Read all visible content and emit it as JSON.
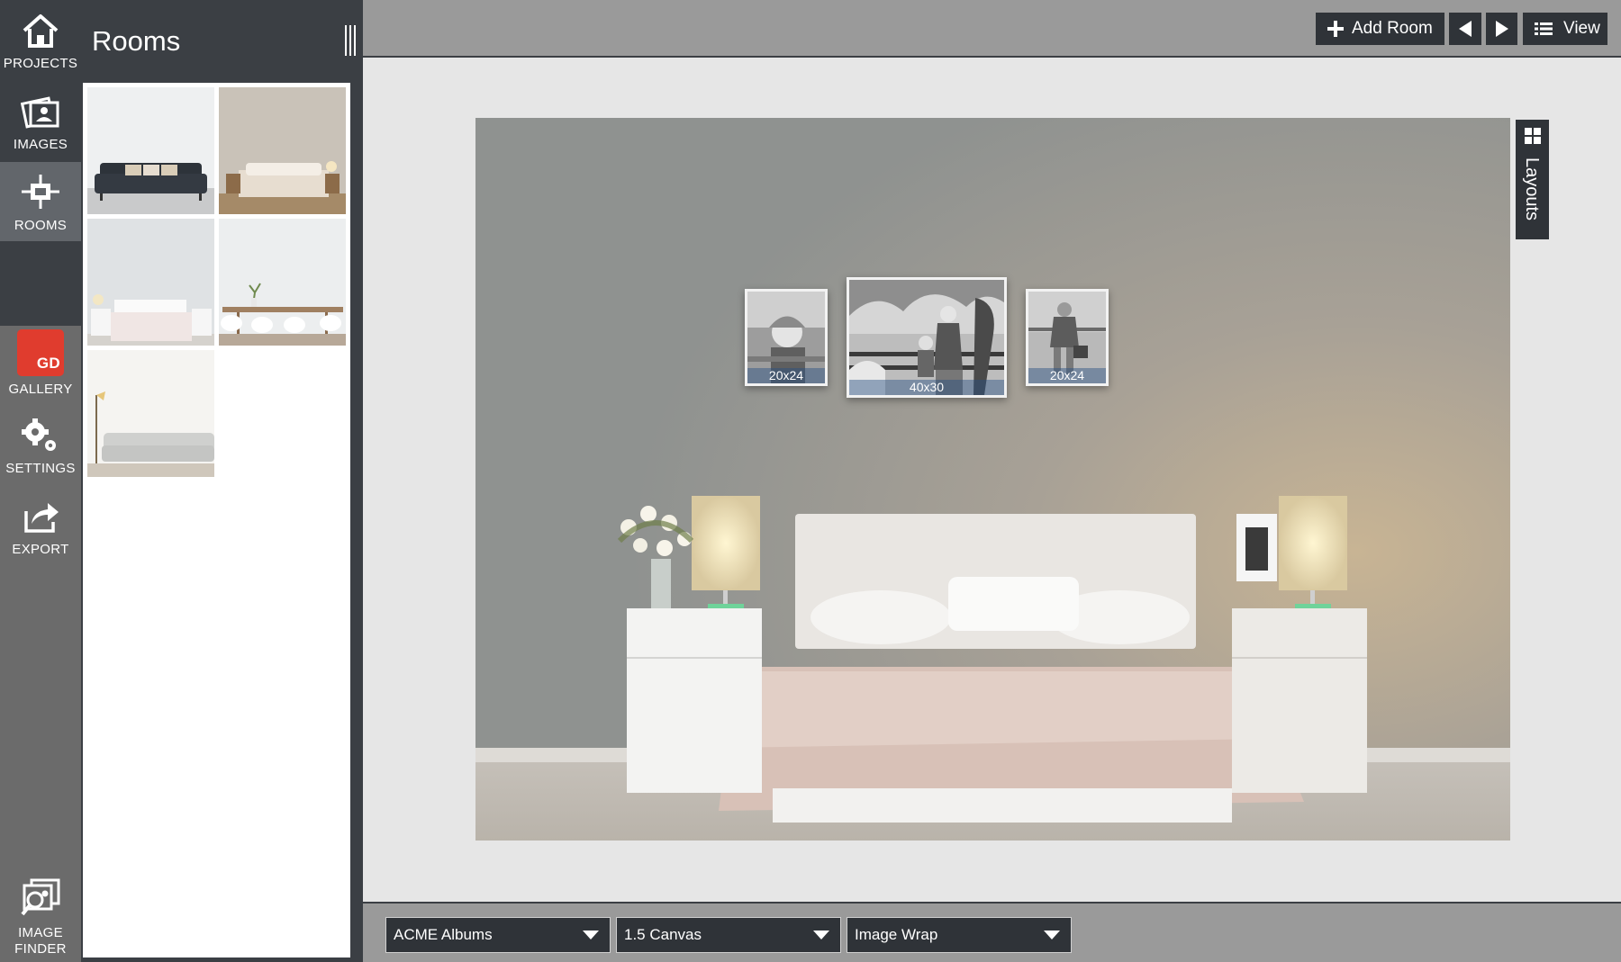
{
  "nav": {
    "projects": "PROJECTS",
    "images": "IMAGES",
    "rooms": "ROOMS",
    "gallery": "GALLERY",
    "gallery_badge": "GD",
    "settings": "SETTINGS",
    "export": "EXPORT",
    "image_finder_1": "IMAGE",
    "image_finder_2": "FINDER"
  },
  "panel": {
    "title": "Rooms"
  },
  "toolbar": {
    "add_room": "Add Room",
    "view": "View"
  },
  "layouts": {
    "label": "Layouts"
  },
  "artworks": [
    {
      "size": "20x24"
    },
    {
      "size": "40x30"
    },
    {
      "size": "20x24"
    }
  ],
  "bottom": {
    "album": "ACME Albums",
    "canvas": "1.5 Canvas",
    "wrap": "Image Wrap"
  },
  "colors": {
    "dark": "#3b3f44",
    "button": "#2f3338",
    "rail": "#6b6b6b",
    "gallery_red": "#e03c2e"
  }
}
